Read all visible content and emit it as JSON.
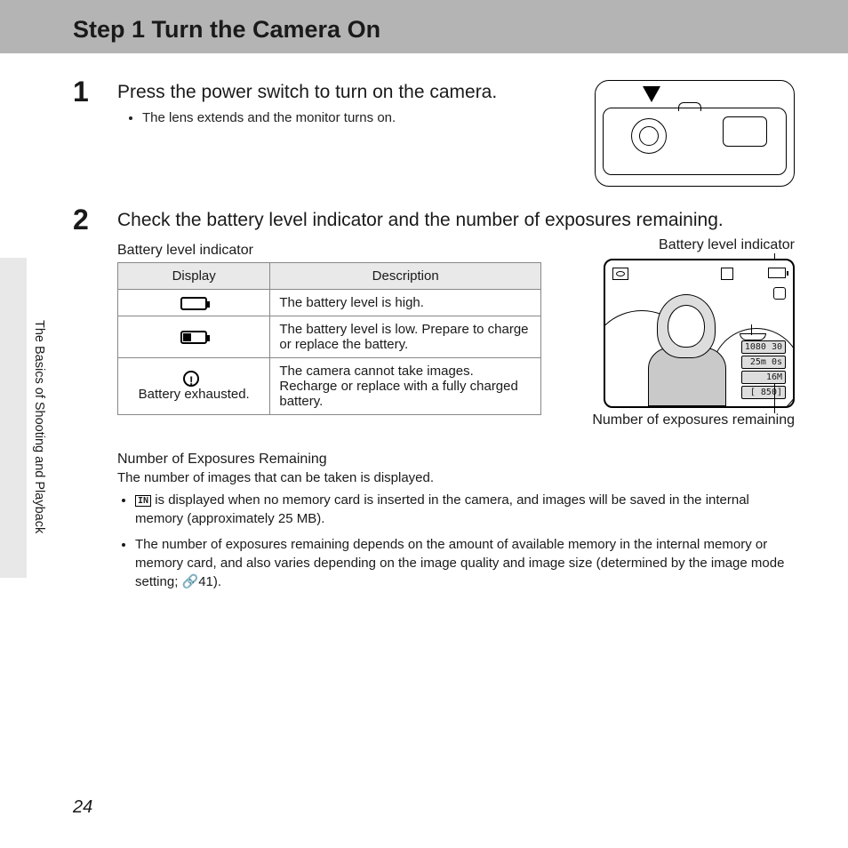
{
  "header": {
    "title": "Step 1 Turn the Camera On"
  },
  "side": {
    "chapter": "The Basics of Shooting and Playback"
  },
  "page_number": "24",
  "step1": {
    "num": "1",
    "instruction": "Press the power switch to turn on the camera.",
    "bullet1": "The lens extends and the monitor turns on."
  },
  "step2": {
    "num": "2",
    "instruction": "Check the battery level indicator and the number of exposures remaining.",
    "table_caption": "Battery level indicator",
    "th_display": "Display",
    "th_desc": "Description",
    "row1_desc": "The battery level is high.",
    "row2_desc": "The battery level is low. Prepare to charge or replace the battery.",
    "row3_disp": "Battery exhausted.",
    "row3_desc": "The camera cannot take images. Recharge or replace with a fully charged battery.",
    "screen_top_label": "Battery level indicator",
    "screen_bottom_label": "Number of exposures remaining",
    "screen_vals": {
      "t1": "1080 30",
      "t2": "25m 0s",
      "t3": "16M",
      "t4": "[  850]"
    }
  },
  "exposures": {
    "title": "Number of Exposures Remaining",
    "lead": "The number of images that can be taken is displayed.",
    "b1a": " is displayed when no memory card is inserted in the camera, and images will be saved in the internal memory (approximately 25 MB).",
    "b2": "The number of exposures remaining depends on the amount of available memory in the internal memory or memory card, and also varies depending on the image quality and image size (determined by the image mode setting; ",
    "b2ref": "41)."
  }
}
